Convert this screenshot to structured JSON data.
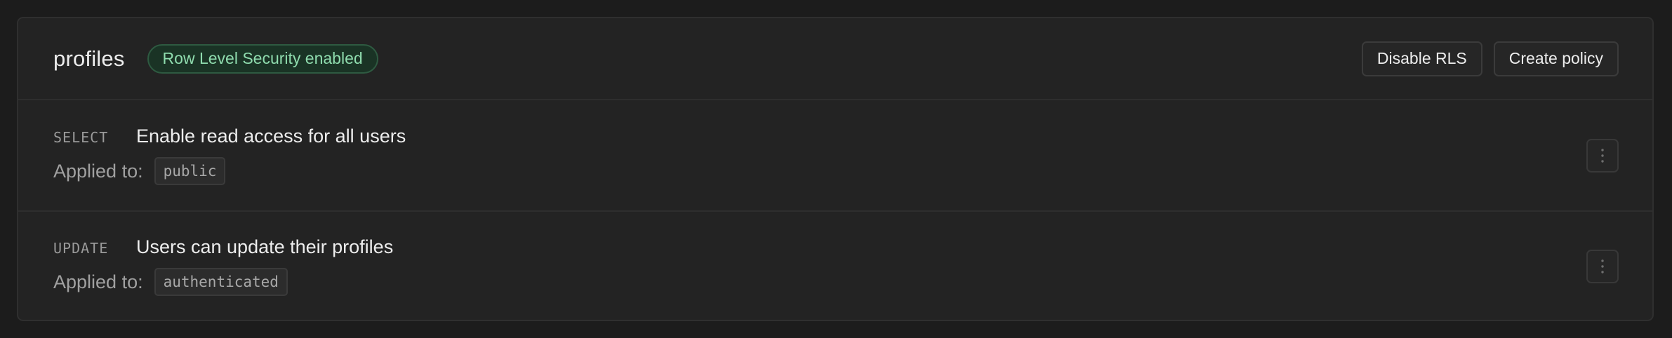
{
  "table": {
    "name": "profiles",
    "rls_badge": "Row Level Security enabled"
  },
  "actions": {
    "disable_rls": "Disable RLS",
    "create_policy": "Create policy"
  },
  "policies": [
    {
      "command": "SELECT",
      "name": "Enable read access for all users",
      "applied_label": "Applied to:",
      "role": "public",
      "menu_icon": "more-vertical-icon"
    },
    {
      "command": "UPDATE",
      "name": "Users can update their profiles",
      "applied_label": "Applied to:",
      "role": "authenticated",
      "menu_icon": "more-vertical-icon"
    }
  ],
  "colors": {
    "background": "#1c1c1c",
    "card": "#232323",
    "badge_text": "#8fdcae",
    "badge_bg": "#1a3325"
  }
}
